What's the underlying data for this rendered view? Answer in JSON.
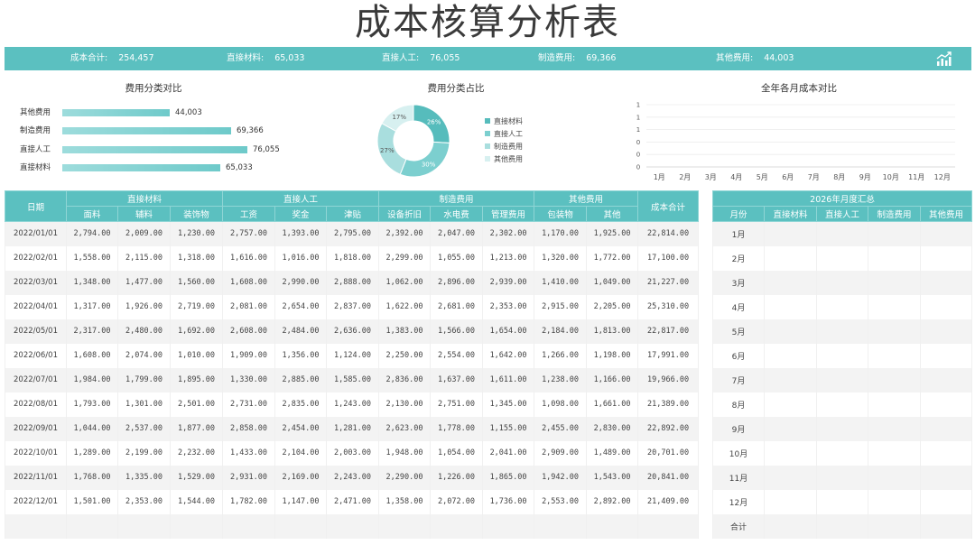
{
  "title": "成本核算分析表",
  "summary": [
    {
      "label": "成本合计:",
      "value": "254,457"
    },
    {
      "label": "直接材料:",
      "value": "65,033"
    },
    {
      "label": "直接人工:",
      "value": "76,055"
    },
    {
      "label": "制造费用:",
      "value": "69,366"
    },
    {
      "label": "其他费用:",
      "value": "44,003"
    }
  ],
  "icons": {
    "trend": "trend-chart-icon"
  },
  "colors": {
    "accent": "#5bc0c0",
    "bar": "#7fd0d0",
    "donut": [
      "#56bcbc",
      "#7ccfcf",
      "#a9dede",
      "#d7f0f0"
    ]
  },
  "expense_compare": {
    "title": "费用分类对比",
    "items": [
      {
        "label": "其他费用",
        "value_text": "44,003"
      },
      {
        "label": "制造费用",
        "value_text": "69,366"
      },
      {
        "label": "直接人工",
        "value_text": "76,055"
      },
      {
        "label": "直接材料",
        "value_text": "65,033"
      }
    ]
  },
  "expense_share": {
    "title": "费用分类占比",
    "legend": [
      "直接材料",
      "直接人工",
      "制造费用",
      "其他费用"
    ]
  },
  "monthly_compare": {
    "title": "全年各月成本对比"
  },
  "chart_data": [
    {
      "type": "bar",
      "orientation": "horizontal",
      "title": "费用分类对比",
      "categories": [
        "其他费用",
        "制造费用",
        "直接人工",
        "直接材料"
      ],
      "values": [
        44003,
        69366,
        76055,
        65033
      ],
      "legend": "none",
      "grid": false
    },
    {
      "type": "pie",
      "variant": "donut",
      "title": "费用分类占比",
      "categories": [
        "直接材料",
        "直接人工",
        "制造费用",
        "其他费用"
      ],
      "values": [
        26,
        30,
        27,
        17
      ],
      "data_labels": [
        "26%",
        "30%",
        "27%",
        "17%"
      ],
      "legend": "right"
    },
    {
      "type": "line",
      "title": "全年各月成本对比",
      "categories": [
        "1月",
        "2月",
        "3月",
        "4月",
        "5月",
        "6月",
        "7月",
        "8月",
        "9月",
        "10月",
        "11月",
        "12月"
      ],
      "y_tick_labels": [
        "0",
        "0",
        "0",
        "1",
        "1",
        "1"
      ],
      "series": [],
      "grid": true
    }
  ],
  "table": {
    "date_header": "日期",
    "total_header": "成本合计",
    "groups": [
      {
        "label": "直接材料",
        "cols": [
          "面料",
          "辅料",
          "装饰物"
        ]
      },
      {
        "label": "直接人工",
        "cols": [
          "工资",
          "奖金",
          "津贴"
        ]
      },
      {
        "label": "制造费用",
        "cols": [
          "设备折旧",
          "水电费",
          "管理费用"
        ]
      },
      {
        "label": "其他费用",
        "cols": [
          "包装物",
          "其他"
        ]
      }
    ],
    "rows": [
      [
        "2022/01/01",
        "2,794.00",
        "2,009.00",
        "1,230.00",
        "2,757.00",
        "1,393.00",
        "2,795.00",
        "2,392.00",
        "2,047.00",
        "2,302.00",
        "1,170.00",
        "1,925.00",
        "22,814.00"
      ],
      [
        "2022/02/01",
        "1,558.00",
        "2,115.00",
        "1,318.00",
        "1,616.00",
        "1,016.00",
        "1,818.00",
        "2,299.00",
        "1,055.00",
        "1,213.00",
        "1,320.00",
        "1,772.00",
        "17,100.00"
      ],
      [
        "2022/03/01",
        "1,348.00",
        "1,477.00",
        "1,560.00",
        "1,608.00",
        "2,990.00",
        "2,888.00",
        "1,062.00",
        "2,896.00",
        "2,939.00",
        "1,410.00",
        "1,049.00",
        "21,227.00"
      ],
      [
        "2022/04/01",
        "1,317.00",
        "1,926.00",
        "2,719.00",
        "2,081.00",
        "2,654.00",
        "2,837.00",
        "1,622.00",
        "2,681.00",
        "2,353.00",
        "2,915.00",
        "2,205.00",
        "25,310.00"
      ],
      [
        "2022/05/01",
        "2,317.00",
        "2,480.00",
        "1,692.00",
        "2,608.00",
        "2,484.00",
        "2,636.00",
        "1,383.00",
        "1,566.00",
        "1,654.00",
        "2,184.00",
        "1,813.00",
        "22,817.00"
      ],
      [
        "2022/06/01",
        "1,608.00",
        "2,074.00",
        "1,010.00",
        "1,909.00",
        "1,356.00",
        "1,124.00",
        "2,250.00",
        "2,554.00",
        "1,642.00",
        "1,266.00",
        "1,198.00",
        "17,991.00"
      ],
      [
        "2022/07/01",
        "1,984.00",
        "1,799.00",
        "1,895.00",
        "1,330.00",
        "2,885.00",
        "1,585.00",
        "2,836.00",
        "1,637.00",
        "1,611.00",
        "1,238.00",
        "1,166.00",
        "19,966.00"
      ],
      [
        "2022/08/01",
        "1,793.00",
        "1,301.00",
        "2,501.00",
        "2,731.00",
        "2,835.00",
        "1,243.00",
        "2,130.00",
        "2,751.00",
        "1,345.00",
        "1,098.00",
        "1,661.00",
        "21,389.00"
      ],
      [
        "2022/09/01",
        "1,044.00",
        "2,537.00",
        "1,877.00",
        "2,858.00",
        "2,454.00",
        "1,281.00",
        "2,623.00",
        "1,778.00",
        "1,155.00",
        "2,455.00",
        "2,830.00",
        "22,892.00"
      ],
      [
        "2022/10/01",
        "1,289.00",
        "2,199.00",
        "2,232.00",
        "1,433.00",
        "2,104.00",
        "2,003.00",
        "1,948.00",
        "1,054.00",
        "2,041.00",
        "2,909.00",
        "1,489.00",
        "20,701.00"
      ],
      [
        "2022/11/01",
        "1,768.00",
        "1,335.00",
        "1,529.00",
        "2,931.00",
        "2,169.00",
        "2,243.00",
        "2,290.00",
        "1,226.00",
        "1,865.00",
        "1,942.00",
        "1,543.00",
        "20,841.00"
      ],
      [
        "2022/12/01",
        "1,501.00",
        "2,353.00",
        "1,544.00",
        "1,782.00",
        "1,147.00",
        "2,471.00",
        "1,358.00",
        "2,072.00",
        "1,736.00",
        "2,553.00",
        "2,892.00",
        "21,409.00"
      ],
      [
        "",
        "",
        "",
        "",
        "",
        "",
        "",
        "",
        "",
        "",
        "",
        "",
        ""
      ]
    ]
  },
  "monthly_summary": {
    "title": "2026年月度汇总",
    "headers": [
      "月份",
      "直接材料",
      "直接人工",
      "制造费用",
      "其他费用"
    ],
    "months": [
      "1月",
      "2月",
      "3月",
      "4月",
      "5月",
      "6月",
      "7月",
      "8月",
      "9月",
      "10月",
      "11月",
      "12月"
    ],
    "total_label": "合计"
  }
}
